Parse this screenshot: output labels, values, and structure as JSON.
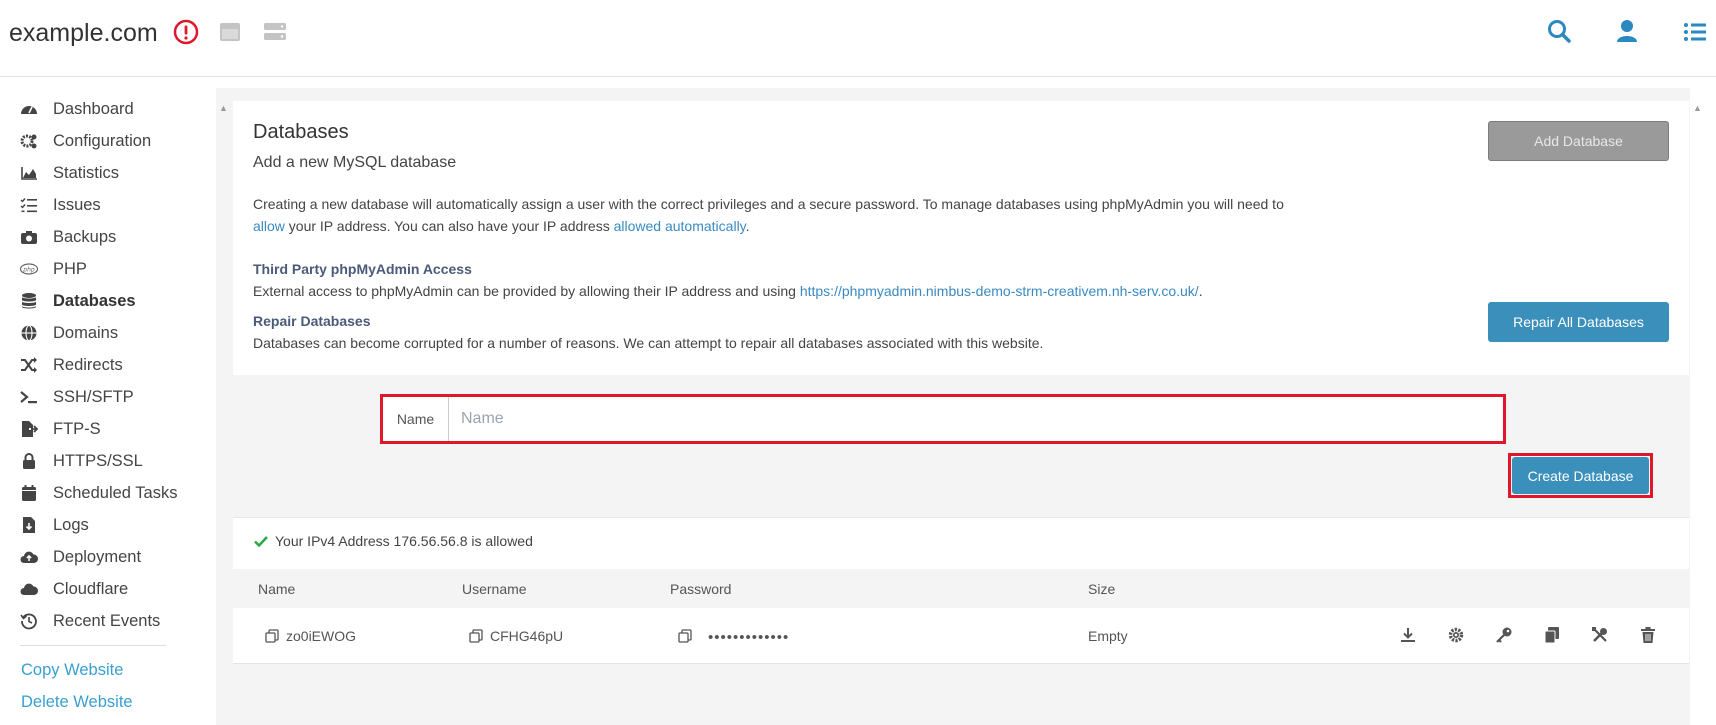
{
  "header": {
    "site_title": "example.com"
  },
  "sidebar": {
    "items": [
      {
        "label": "Dashboard",
        "icon": "gauge-icon"
      },
      {
        "label": "Configuration",
        "icon": "gears-icon"
      },
      {
        "label": "Statistics",
        "icon": "area-chart-icon"
      },
      {
        "label": "Issues",
        "icon": "checklist-icon"
      },
      {
        "label": "Backups",
        "icon": "camera-icon"
      },
      {
        "label": "PHP",
        "icon": "php-icon"
      },
      {
        "label": "Databases",
        "icon": "database-icon",
        "active": true
      },
      {
        "label": "Domains",
        "icon": "globe-icon"
      },
      {
        "label": "Redirects",
        "icon": "shuffle-icon"
      },
      {
        "label": "SSH/SFTP",
        "icon": "terminal-icon"
      },
      {
        "label": "FTP-S",
        "icon": "file-export-icon"
      },
      {
        "label": "HTTPS/SSL",
        "icon": "lock-icon"
      },
      {
        "label": "Scheduled Tasks",
        "icon": "calendar-icon"
      },
      {
        "label": "Logs",
        "icon": "file-download-icon"
      },
      {
        "label": "Deployment",
        "icon": "cloud-upload-icon"
      },
      {
        "label": "Cloudflare",
        "icon": "cloud-icon"
      },
      {
        "label": "Recent Events",
        "icon": "history-icon"
      }
    ],
    "copy_website": "Copy Website",
    "delete_website": "Delete Website"
  },
  "main": {
    "title": "Databases",
    "subtitle": "Add a new MySQL database",
    "intro_1": "Creating a new database will automatically assign a user with the correct privileges and a secure password. To manage databases using phpMyAdmin you will need to ",
    "intro_link_1": "allow",
    "intro_2": " your IP address. You can also have your IP address ",
    "intro_link_2": "allowed automatically",
    "intro_3": ".",
    "third_party_heading": "Third Party phpMyAdmin Access",
    "third_party_text": "External access to phpMyAdmin can be provided by allowing their IP address and using ",
    "third_party_link": "https://phpmyadmin.nimbus-demo-strm-creativem.nh-serv.co.uk/",
    "third_party_end": ".",
    "repair_heading": "Repair Databases",
    "repair_text": "Databases can become corrupted for a number of reasons. We can attempt to repair all databases associated with this website.",
    "add_database_label": "Add Database",
    "repair_all_label": "Repair All Databases"
  },
  "form": {
    "name_label": "Name",
    "name_placeholder": "Name",
    "name_value": "",
    "create_label": "Create Database"
  },
  "ip_notice": "Your IPv4 Address 176.56.56.8 is allowed",
  "table": {
    "headers": [
      "Name",
      "Username",
      "Password",
      "Size"
    ],
    "rows": [
      {
        "name": "zo0iEWOG",
        "username": "CFHG46pU",
        "password": "•••••••••••••",
        "size": "Empty"
      }
    ]
  },
  "colors": {
    "accent": "#3a8fbb",
    "link": "#3a9fd0",
    "highlight": "#e0162b",
    "success": "#28a745"
  }
}
